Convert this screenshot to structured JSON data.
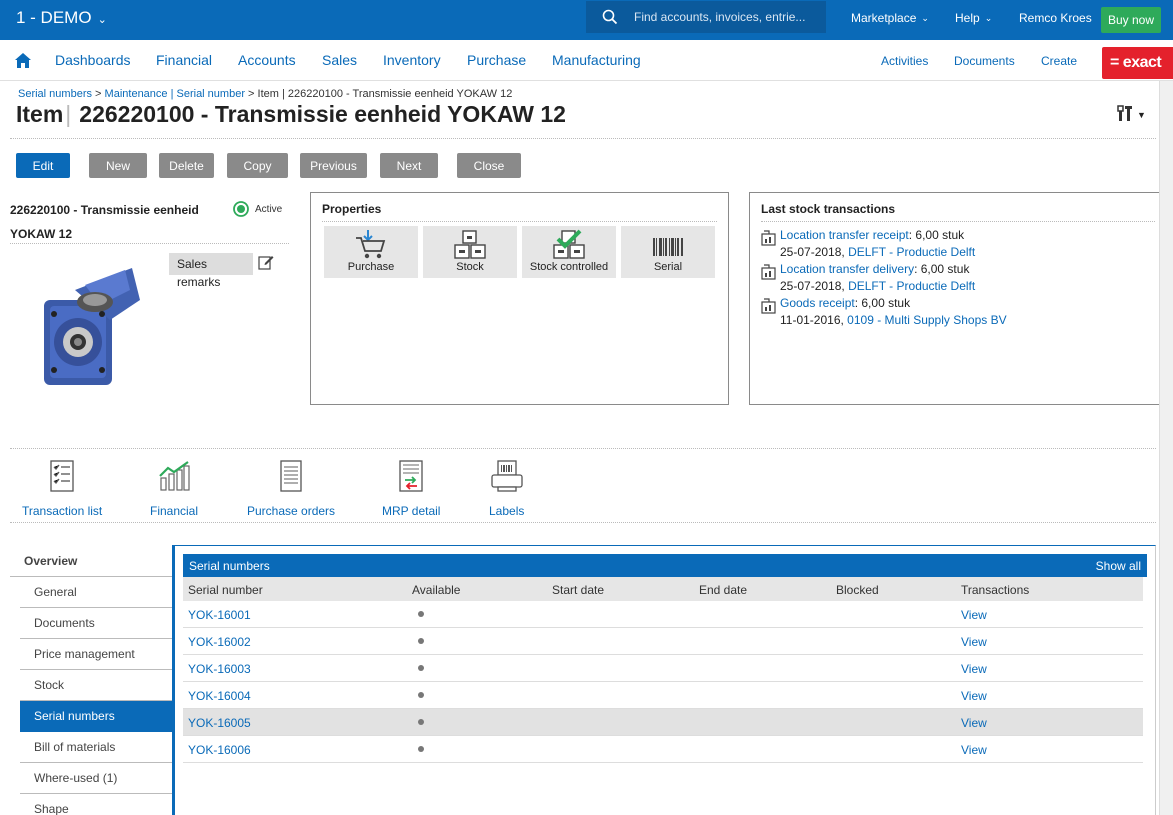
{
  "topbar": {
    "company": "1 - DEMO",
    "search_placeholder": "Find accounts, invoices, entrie...",
    "marketplace": "Marketplace",
    "help": "Help",
    "user": "Remco Kroes",
    "buy_now": "Buy now",
    "background": "#0a6ab8"
  },
  "nav": {
    "items": [
      "Dashboards",
      "Financial",
      "Accounts",
      "Sales",
      "Inventory",
      "Purchase",
      "Manufacturing"
    ],
    "right": [
      "Activities",
      "Documents",
      "Create"
    ],
    "logo": "= exact"
  },
  "header": {
    "breadcrumb": {
      "link1": "Serial numbers",
      "link2": "Maintenance | Serial number",
      "rest": "Item | 226220100 - Transmissie eenheid YOKAW 12",
      "sep": ">"
    },
    "title_prefix": "Item",
    "title_sep": "|",
    "title": "226220100 - Transmissie eenheid YOKAW 12"
  },
  "actions": {
    "edit": "Edit",
    "new": "New",
    "delete": "Delete",
    "copy": "Copy",
    "previous": "Previous",
    "next": "Next",
    "close": "Close"
  },
  "item": {
    "name_line1": "226220100 - Transmissie eenheid",
    "name_line2": "YOKAW 12",
    "status": "Active",
    "sales_label": "Sales",
    "remarks_label": "remarks"
  },
  "properties": {
    "title": "Properties",
    "tiles": [
      "Purchase",
      "Stock",
      "Stock controlled",
      "Serial"
    ]
  },
  "stock_transactions": {
    "title": "Last stock transactions",
    "rows": [
      {
        "type": "Location transfer receipt",
        "qty": ": 6,00 stuk",
        "date": "25-07-2018, ",
        "location": "DELFT - Productie Delft"
      },
      {
        "type": "Location transfer delivery",
        "qty": ": 6,00 stuk",
        "date": "25-07-2018, ",
        "location": "DELFT - Productie Delft"
      },
      {
        "type": "Goods receipt",
        "qty": ": 6,00 stuk",
        "date": "11-01-2016, ",
        "location": "0109 - Multi Supply Shops BV"
      }
    ]
  },
  "shortcuts": [
    "Transaction list",
    "Financial",
    "Purchase orders",
    "MRP detail",
    "Labels"
  ],
  "left_menu": {
    "overview": "Overview",
    "items": [
      "General",
      "Documents",
      "Price management",
      "Stock",
      "Serial numbers",
      "Bill of materials",
      "Where-used (1)",
      "Shape"
    ],
    "selected": "Serial numbers"
  },
  "serial_numbers": {
    "title": "Serial numbers",
    "show_all": "Show all",
    "columns": [
      "Serial number",
      "Available",
      "Start date",
      "End date",
      "Blocked",
      "Transactions"
    ],
    "rows": [
      {
        "serial": "YOK-16001",
        "available": true,
        "transactions": "View"
      },
      {
        "serial": "YOK-16002",
        "available": true,
        "transactions": "View"
      },
      {
        "serial": "YOK-16003",
        "available": true,
        "transactions": "View"
      },
      {
        "serial": "YOK-16004",
        "available": true,
        "transactions": "View"
      },
      {
        "serial": "YOK-16005",
        "available": true,
        "transactions": "View"
      },
      {
        "serial": "YOK-16006",
        "available": true,
        "transactions": "View"
      }
    ]
  }
}
